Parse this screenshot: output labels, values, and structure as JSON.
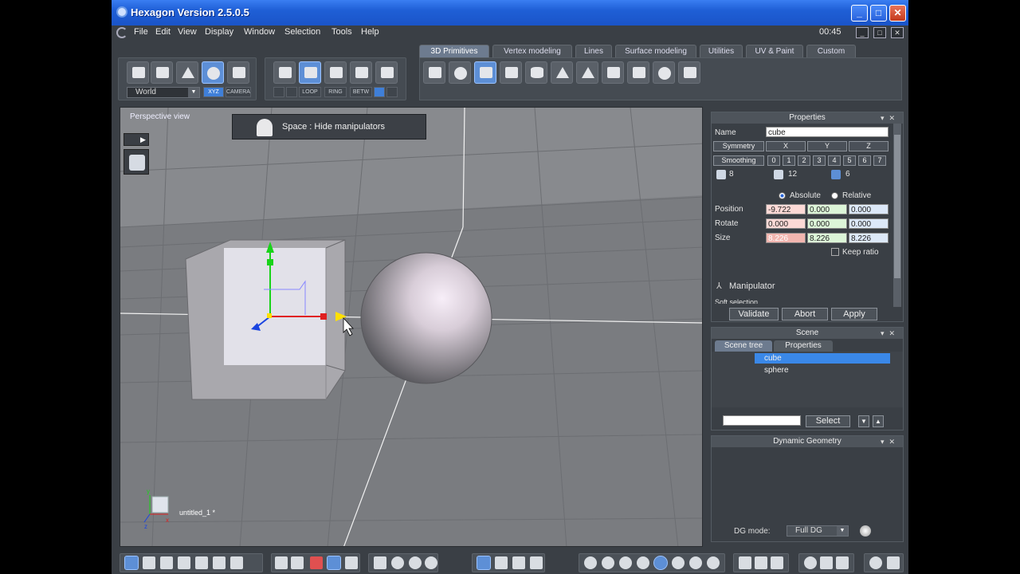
{
  "window": {
    "title": "Hexagon Version 2.5.0.5",
    "controls": [
      "_",
      "□",
      "✕"
    ]
  },
  "menu": {
    "items": [
      "File",
      "Edit",
      "View",
      "Display",
      "Window",
      "Selection",
      "Tools",
      "Help"
    ],
    "clock": "00:45",
    "controls": [
      "_",
      "□",
      "✕"
    ]
  },
  "toolbar": {
    "coord_select": "World",
    "xyz_label": "XYZ",
    "camera_label": "CAMERA",
    "loop_label": "LOOP",
    "ring_label": "RING",
    "betw_label": "BETW",
    "tabs": [
      "3D Primitives",
      "Vertex modeling",
      "Lines",
      "Surface modeling",
      "Utilities",
      "UV & Paint",
      "Custom"
    ],
    "active_tab": "3D Primitives"
  },
  "viewport": {
    "label": "Perspective view",
    "hint": "Space : Hide manipulators",
    "document_name": "untitled_1 *",
    "axis_labels": [
      "y",
      "x",
      "z"
    ]
  },
  "properties": {
    "title": "Properties",
    "name_label": "Name",
    "name_value": "cube",
    "symmetry_label": "Symmetry",
    "symmetry_axes": [
      "X",
      "Y",
      "Z"
    ],
    "smoothing_label": "Smoothing",
    "smoothing_levels": [
      "0",
      "1",
      "2",
      "3",
      "4",
      "5",
      "6",
      "7"
    ],
    "counts": [
      "8",
      "12",
      "6"
    ],
    "mode_absolute": "Absolute",
    "mode_relative": "Relative",
    "position_label": "Position",
    "position": [
      "-9.722",
      "0.000",
      "0.000"
    ],
    "rotate_label": "Rotate",
    "rotate": [
      "0.000",
      "0.000",
      "0.000"
    ],
    "size_label": "Size",
    "size": [
      "8.226",
      "8.226",
      "8.226"
    ],
    "keep_ratio": "Keep ratio",
    "manipulator": "Manipulator",
    "soft_selection": "Soft selection",
    "validate": "Validate",
    "abort": "Abort",
    "apply": "Apply"
  },
  "scene": {
    "title": "Scene",
    "tabs": [
      "Scene tree",
      "Properties"
    ],
    "items": [
      "cube",
      "sphere"
    ],
    "select_label": "Select",
    "search_value": ""
  },
  "dynamic_geometry": {
    "title": "Dynamic Geometry",
    "mode_label": "DG mode:",
    "mode_value": "Full DG"
  }
}
